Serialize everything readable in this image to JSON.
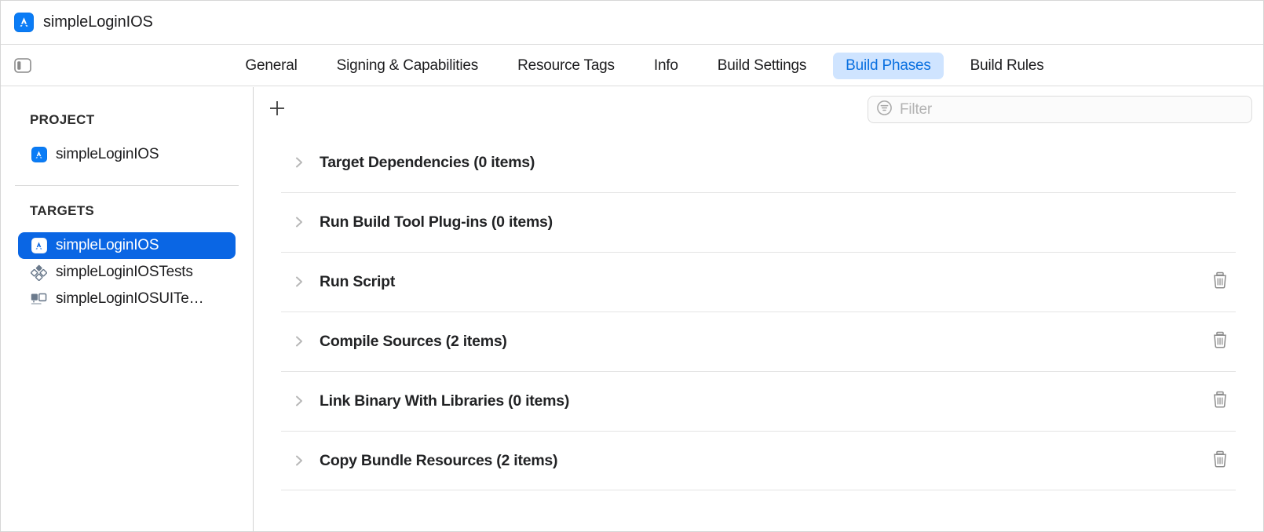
{
  "window": {
    "title": "simpleLoginIOS",
    "app_icon": "app-store-icon"
  },
  "tabbar": {
    "sidebar_toggle_icon": "sidebar-toggle-icon",
    "tabs": [
      {
        "label": "General",
        "selected": false
      },
      {
        "label": "Signing & Capabilities",
        "selected": false
      },
      {
        "label": "Resource Tags",
        "selected": false
      },
      {
        "label": "Info",
        "selected": false
      },
      {
        "label": "Build Settings",
        "selected": false
      },
      {
        "label": "Build Phases",
        "selected": true
      },
      {
        "label": "Build Rules",
        "selected": false
      }
    ],
    "selected_tab": "Build Phases",
    "selected_tab_bg": "#cfe4ff",
    "selected_tab_color": "#0a70e0"
  },
  "sidebar": {
    "project_header": "PROJECT",
    "project_items": [
      {
        "label": "simpleLoginIOS",
        "icon": "app-store-icon",
        "selected": false
      }
    ],
    "targets_header": "TARGETS",
    "target_items": [
      {
        "label": "simpleLoginIOS",
        "icon": "app-store-icon",
        "selected": true
      },
      {
        "label": "simpleLoginIOSTests",
        "icon": "unit-test-diamond-icon",
        "selected": false
      },
      {
        "label": "simpleLoginIOSUITe…",
        "icon": "ui-test-screen-icon",
        "selected": false
      }
    ],
    "selection_color": "#0a66e4"
  },
  "toolbar": {
    "add_button_icon": "plus-icon",
    "add_button_label": "+",
    "filter": {
      "icon": "filter-icon",
      "placeholder": "Filter",
      "value": ""
    }
  },
  "build_phases": [
    {
      "title": "Target Dependencies (0 items)",
      "expanded": false,
      "deletable": false
    },
    {
      "title": "Run Build Tool Plug-ins (0 items)",
      "expanded": false,
      "deletable": false
    },
    {
      "title": "Run Script",
      "expanded": false,
      "deletable": true
    },
    {
      "title": "Compile Sources (2 items)",
      "expanded": false,
      "deletable": true
    },
    {
      "title": "Link Binary With Libraries (0 items)",
      "expanded": false,
      "deletable": true
    },
    {
      "title": "Copy Bundle Resources (2 items)",
      "expanded": false,
      "deletable": true
    }
  ],
  "icons": {
    "disclosure": "chevron-right-icon",
    "delete": "trash-icon"
  }
}
